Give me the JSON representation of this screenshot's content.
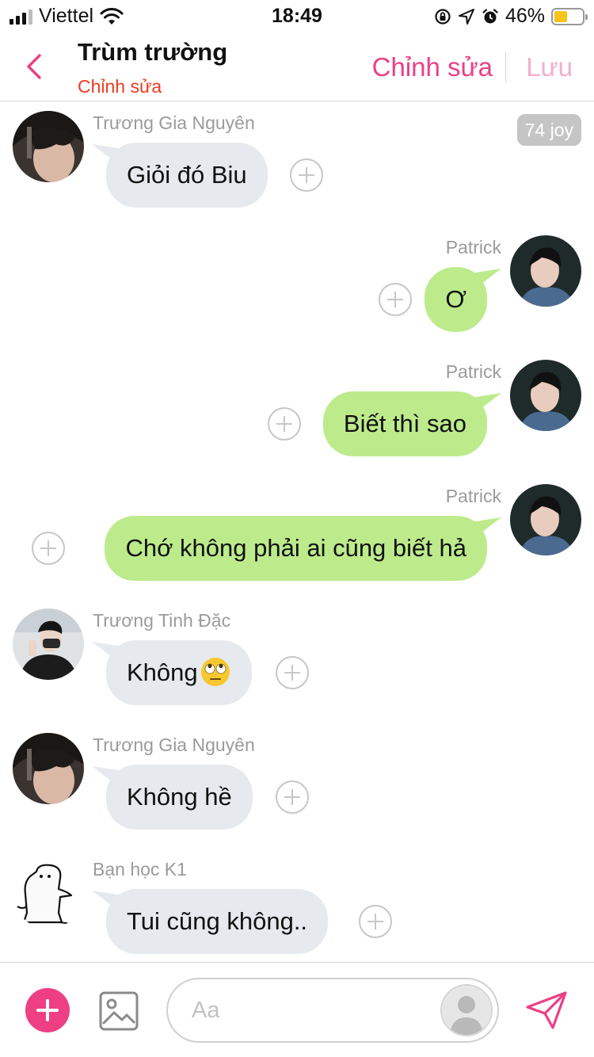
{
  "status_bar": {
    "carrier": "Viettel",
    "time": "18:49",
    "battery_pct": "46%",
    "battery_level": 0.46
  },
  "header": {
    "title": "Trùm trường",
    "subtitle": "Chỉnh sửa",
    "edit_label": "Chỉnh sửa",
    "save_label": "Lưu"
  },
  "joy_badge": "74 joy",
  "messages": [
    {
      "side": "left",
      "sender": "Trương Gia Nguyên",
      "text": "Giỏi đó Biu",
      "avatar": "guy-long-hair-avatar"
    },
    {
      "side": "right",
      "sender": "Patrick",
      "text": "Ơ",
      "avatar": "patrick-avatar"
    },
    {
      "side": "right",
      "sender": "Patrick",
      "text": "Biết thì sao",
      "avatar": "patrick-avatar"
    },
    {
      "side": "right",
      "sender": "Patrick",
      "text": "Chớ không phải ai cũng biết hả",
      "avatar": "patrick-avatar"
    },
    {
      "side": "left",
      "sender": "Trương Tinh Đặc",
      "text": "Không",
      "emoji": "eye-roll-emoji",
      "avatar": "masked-guy-avatar"
    },
    {
      "side": "left",
      "sender": "Trương Gia Nguyên",
      "text": "Không hề",
      "avatar": "guy-long-hair-avatar"
    },
    {
      "side": "left",
      "sender": "Bạn học K1",
      "text": "Tui cũng không..",
      "avatar": "doodle-creature-avatar"
    }
  ],
  "composer": {
    "placeholder": "Aa"
  },
  "colors": {
    "accent_pink": "#ec3f86",
    "subtitle_red": "#ee3a1c",
    "own_bubble": "#bdeb8c",
    "other_bubble": "#e6e9ee"
  }
}
